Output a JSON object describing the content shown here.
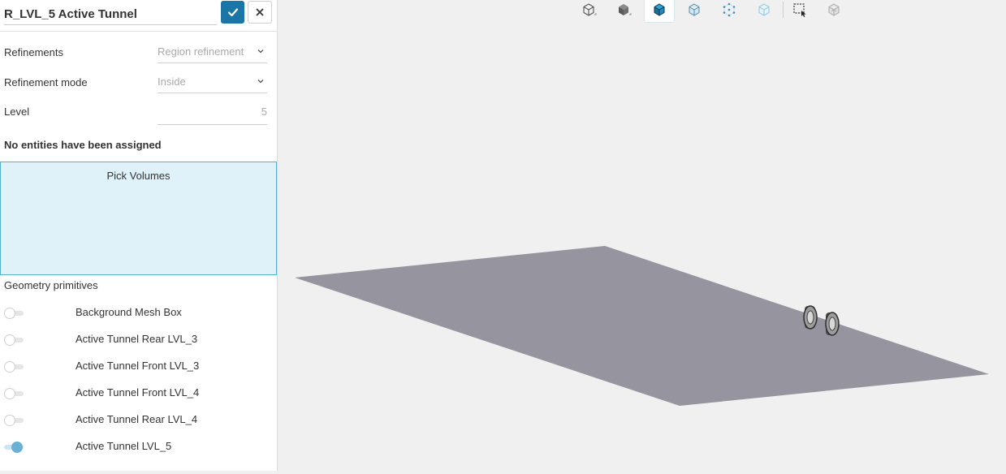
{
  "panel": {
    "title": "R_LVL_5 Active Tunnel",
    "refinements_label": "Refinements",
    "refinements_value": "Region refinement",
    "mode_label": "Refinement mode",
    "mode_value": "Inside",
    "level_label": "Level",
    "level_value": "5",
    "no_entities": "No entities have been assigned",
    "pick_label": "Pick Volumes",
    "primitives_heading": "Geometry primitives",
    "primitives": [
      {
        "label": "Background Mesh Box",
        "on": false
      },
      {
        "label": "Active Tunnel Rear LVL_3",
        "on": false
      },
      {
        "label": "Active Tunnel Front LVL_3",
        "on": false
      },
      {
        "label": "Active Tunnel Front LVL_4",
        "on": false
      },
      {
        "label": "Active Tunnel Rear LVL_4",
        "on": false
      },
      {
        "label": "Active Tunnel LVL_5",
        "on": true
      }
    ]
  },
  "toolbar": {
    "buttons": [
      {
        "icon": "cube-outline-icon",
        "active": false
      },
      {
        "icon": "cube-solid-icon",
        "active": false
      },
      {
        "icon": "cube-solid-edges-icon",
        "active": true
      },
      {
        "icon": "cube-transparent-icon",
        "active": false
      },
      {
        "icon": "cube-points-icon",
        "active": false
      },
      {
        "icon": "cube-light-icon",
        "active": false
      },
      {
        "icon": "box-select-icon",
        "active": false
      },
      {
        "icon": "hide-selection-icon",
        "active": false
      }
    ]
  },
  "colors": {
    "accent": "#1b75a6",
    "pick_bg": "#dff1f9",
    "pick_border": "#5aaed3",
    "plane": "#96959f",
    "viewport_bg": "#f0f0f0",
    "toggle_on": "#6ab1d6"
  }
}
